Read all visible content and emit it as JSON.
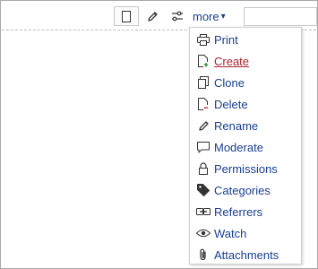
{
  "toolbar": {
    "more_label": "more",
    "more_caret": "▾",
    "buttons": [
      {
        "icon": "page-icon"
      },
      {
        "icon": "pencil-icon"
      },
      {
        "icon": "sliders-icon"
      }
    ],
    "search": {
      "value": "",
      "placeholder": ""
    }
  },
  "menu": {
    "items": [
      {
        "label": "Print",
        "icon": "printer-icon"
      },
      {
        "label": "Create",
        "icon": "new-page-icon",
        "active": true
      },
      {
        "label": "Clone",
        "icon": "copy-icon"
      },
      {
        "label": "Delete",
        "icon": "delete-page-icon"
      },
      {
        "label": "Rename",
        "icon": "pencil-icon"
      },
      {
        "label": "Moderate",
        "icon": "comment-icon"
      },
      {
        "label": "Permissions",
        "icon": "lock-icon"
      },
      {
        "label": "Categories",
        "icon": "tag-icon"
      },
      {
        "label": "Referrers",
        "icon": "link-icon"
      },
      {
        "label": "Watch",
        "icon": "eye-icon"
      },
      {
        "label": "Attachments",
        "icon": "paperclip-icon"
      }
    ]
  },
  "colors": {
    "link": "#1a3e8f",
    "active_link": "#a8242f",
    "icon": "#333333",
    "border": "#cfcfcf"
  }
}
